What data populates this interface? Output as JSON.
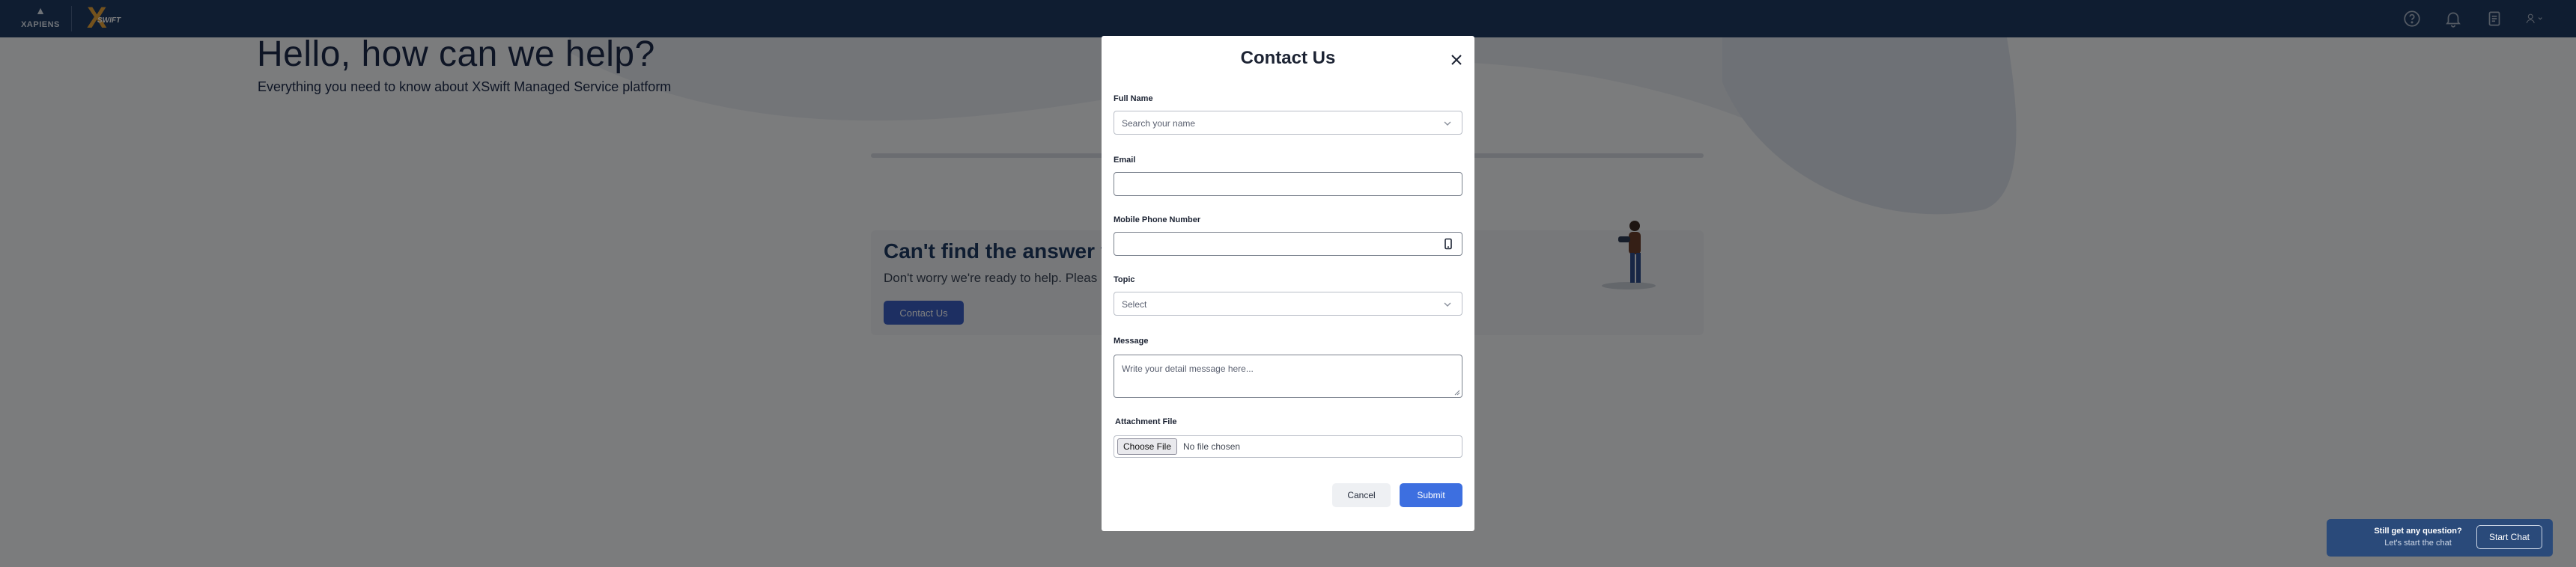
{
  "brand": {
    "company_name": "XAPIENS",
    "product_logo_text": "SWIFT"
  },
  "topbar": {
    "icons": [
      "help-circle-icon",
      "bell-icon",
      "clipboard-icon",
      "user-icon"
    ]
  },
  "hero": {
    "title": "Hello, how can we help?",
    "subtitle": "Everything you need to know about XSwift Managed Service platform"
  },
  "help_card": {
    "title": "Can't find the answer yo",
    "text": "Don't worry we're ready to help. Pleas",
    "button_label": "Contact Us"
  },
  "chat_widget": {
    "title": "Still get any question?",
    "subtitle": "Let's start the chat",
    "button_label": "Start Chat"
  },
  "modal": {
    "title": "Contact Us",
    "fields": {
      "full_name": {
        "label": "Full Name",
        "placeholder": "Search your name",
        "value": ""
      },
      "email": {
        "label": "Email",
        "value": ""
      },
      "phone": {
        "label": "Mobile Phone Number",
        "value": ""
      },
      "topic": {
        "label": "Topic",
        "placeholder": "Select",
        "value": ""
      },
      "message": {
        "label": "Message",
        "placeholder": "Write your detail message here...",
        "value": ""
      },
      "attachment": {
        "label": "Attachment File",
        "button_label": "Choose File",
        "status": "No file chosen"
      }
    },
    "cancel_label": "Cancel",
    "submit_label": "Submit"
  },
  "colors": {
    "topbar": "#1f3a63",
    "primary_button": "#3d6fe0",
    "overlay": "rgba(0,0,0,0.5)",
    "brand_accent": "#e8a43a"
  }
}
